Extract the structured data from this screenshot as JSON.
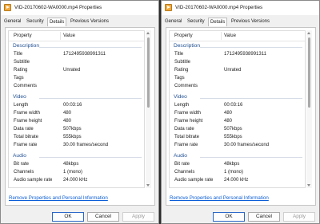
{
  "windows": [
    {
      "title": "VID-20170602-WA0000.mp4 Properties",
      "tabs": [
        "General",
        "Security",
        "Details",
        "Previous Versions"
      ],
      "active_tab": "Details",
      "column_property": "Property",
      "column_value": "Value",
      "sections": [
        {
          "label": "Description",
          "rows": [
            {
              "key": "Title",
              "value": "1712495938991311"
            },
            {
              "key": "Subtitle",
              "value": ""
            },
            {
              "key": "Rating",
              "value": "Unrated"
            },
            {
              "key": "Tags",
              "value": ""
            },
            {
              "key": "Comments",
              "value": ""
            }
          ]
        },
        {
          "label": "Video",
          "rows": [
            {
              "key": "Length",
              "value": "00:03:16"
            },
            {
              "key": "Frame width",
              "value": "480"
            },
            {
              "key": "Frame height",
              "value": "480"
            },
            {
              "key": "Data rate",
              "value": "507kbps"
            },
            {
              "key": "Total bitrate",
              "value": "555kbps"
            },
            {
              "key": "Frame rate",
              "value": "30.00 frames/second"
            }
          ]
        },
        {
          "label": "Audio",
          "rows": [
            {
              "key": "Bit rate",
              "value": "48kbps"
            },
            {
              "key": "Channels",
              "value": "1 (mono)"
            },
            {
              "key": "Audio sample rate",
              "value": "24.000 kHz"
            }
          ]
        }
      ],
      "link": "Remove Properties and Personal Information",
      "buttons": {
        "ok": "OK",
        "cancel": "Cancel",
        "apply": "Apply"
      }
    },
    {
      "title": "VID-20170602-WA0000.mp4 Properties",
      "tabs": [
        "General",
        "Security",
        "Details",
        "Previous Versions"
      ],
      "active_tab": "Details",
      "column_property": "Property",
      "column_value": "Value",
      "sections": [
        {
          "label": "Description",
          "rows": [
            {
              "key": "Title",
              "value": "1712495938991311"
            },
            {
              "key": "Subtitle",
              "value": ""
            },
            {
              "key": "Rating",
              "value": "Unrated"
            },
            {
              "key": "Tags",
              "value": ""
            },
            {
              "key": "Comments",
              "value": ""
            }
          ]
        },
        {
          "label": "Video",
          "rows": [
            {
              "key": "Length",
              "value": "00:03:16"
            },
            {
              "key": "Frame width",
              "value": "480"
            },
            {
              "key": "Frame height",
              "value": "480"
            },
            {
              "key": "Data rate",
              "value": "507kbps"
            },
            {
              "key": "Total bitrate",
              "value": "555kbps"
            },
            {
              "key": "Frame rate",
              "value": "30.00 frames/second"
            }
          ]
        },
        {
          "label": "Audio",
          "rows": [
            {
              "key": "Bit rate",
              "value": "48kbps"
            },
            {
              "key": "Channels",
              "value": "1 (mono)"
            },
            {
              "key": "Audio sample rate",
              "value": "24.000 kHz"
            }
          ]
        }
      ],
      "link": "Remove Properties and Personal Information",
      "buttons": {
        "ok": "OK",
        "cancel": "Cancel",
        "apply": "Apply"
      }
    }
  ]
}
